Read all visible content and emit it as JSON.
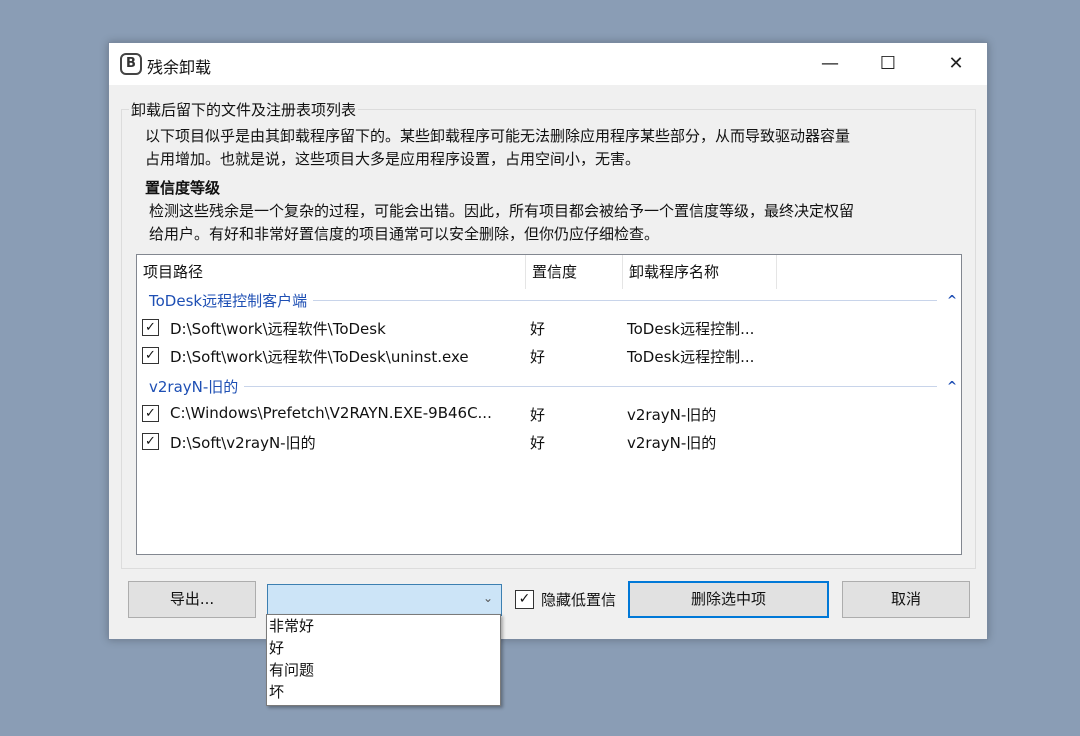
{
  "window": {
    "title": "残余卸载",
    "icon": "B"
  },
  "group_label": "卸载后留下的文件及注册表项列表",
  "intro": [
    "以下项目似乎是由其卸载程序留下的。某些卸载程序可能无法删除应用程序某些部分，从而导致驱动器容量",
    "占用增加。也就是说，这些项目大多是应用程序设置，占用空间小，无害。"
  ],
  "confidence_title": "置信度等级",
  "confidence_text": [
    "检测这些残余是一个复杂的过程，可能会出错。因此，所有项目都会被给予一个置信度等级，最终决定权留",
    "给用户。有好和非常好置信度的项目通常可以安全删除，但你仍应仔细检查。"
  ],
  "columns": [
    "项目路径",
    "置信度",
    "卸载程序名称"
  ],
  "groups": [
    {
      "name": "ToDesk远程控制客户端",
      "rows": [
        {
          "path": "D:\\Soft\\work\\远程软件\\ToDesk",
          "confidence": "好",
          "program": "ToDesk远程控制...",
          "checked": true
        },
        {
          "path": "D:\\Soft\\work\\远程软件\\ToDesk\\uninst.exe",
          "confidence": "好",
          "program": "ToDesk远程控制...",
          "checked": true
        }
      ]
    },
    {
      "name": "v2rayN-旧的",
      "rows": [
        {
          "path": "C:\\Windows\\Prefetch\\V2RAYN.EXE-9B46C...",
          "confidence": "好",
          "program": "v2rayN-旧的",
          "checked": true
        },
        {
          "path": "D:\\Soft\\v2rayN-旧的",
          "confidence": "好",
          "program": "v2rayN-旧的",
          "checked": true
        }
      ]
    }
  ],
  "buttons": {
    "export": "导出...",
    "delete": "删除选中项",
    "cancel": "取消"
  },
  "hide_low": {
    "label": "隐藏低置信",
    "checked": true
  },
  "combo": {
    "value": "",
    "options": [
      "非常好",
      "好",
      "有问题",
      "坏"
    ]
  }
}
